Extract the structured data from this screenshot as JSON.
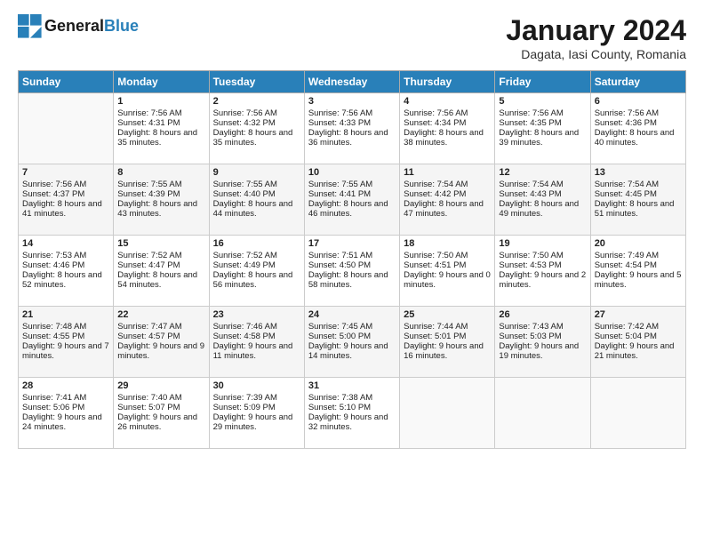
{
  "header": {
    "logo_line1": "General",
    "logo_line2": "Blue",
    "month": "January 2024",
    "location": "Dagata, Iasi County, Romania"
  },
  "days_of_week": [
    "Sunday",
    "Monday",
    "Tuesday",
    "Wednesday",
    "Thursday",
    "Friday",
    "Saturday"
  ],
  "weeks": [
    [
      {
        "day": "",
        "content": ""
      },
      {
        "day": "1",
        "sunrise": "Sunrise: 7:56 AM",
        "sunset": "Sunset: 4:31 PM",
        "daylight": "Daylight: 8 hours and 35 minutes."
      },
      {
        "day": "2",
        "sunrise": "Sunrise: 7:56 AM",
        "sunset": "Sunset: 4:32 PM",
        "daylight": "Daylight: 8 hours and 35 minutes."
      },
      {
        "day": "3",
        "sunrise": "Sunrise: 7:56 AM",
        "sunset": "Sunset: 4:33 PM",
        "daylight": "Daylight: 8 hours and 36 minutes."
      },
      {
        "day": "4",
        "sunrise": "Sunrise: 7:56 AM",
        "sunset": "Sunset: 4:34 PM",
        "daylight": "Daylight: 8 hours and 38 minutes."
      },
      {
        "day": "5",
        "sunrise": "Sunrise: 7:56 AM",
        "sunset": "Sunset: 4:35 PM",
        "daylight": "Daylight: 8 hours and 39 minutes."
      },
      {
        "day": "6",
        "sunrise": "Sunrise: 7:56 AM",
        "sunset": "Sunset: 4:36 PM",
        "daylight": "Daylight: 8 hours and 40 minutes."
      }
    ],
    [
      {
        "day": "7",
        "sunrise": "Sunrise: 7:56 AM",
        "sunset": "Sunset: 4:37 PM",
        "daylight": "Daylight: 8 hours and 41 minutes."
      },
      {
        "day": "8",
        "sunrise": "Sunrise: 7:55 AM",
        "sunset": "Sunset: 4:39 PM",
        "daylight": "Daylight: 8 hours and 43 minutes."
      },
      {
        "day": "9",
        "sunrise": "Sunrise: 7:55 AM",
        "sunset": "Sunset: 4:40 PM",
        "daylight": "Daylight: 8 hours and 44 minutes."
      },
      {
        "day": "10",
        "sunrise": "Sunrise: 7:55 AM",
        "sunset": "Sunset: 4:41 PM",
        "daylight": "Daylight: 8 hours and 46 minutes."
      },
      {
        "day": "11",
        "sunrise": "Sunrise: 7:54 AM",
        "sunset": "Sunset: 4:42 PM",
        "daylight": "Daylight: 8 hours and 47 minutes."
      },
      {
        "day": "12",
        "sunrise": "Sunrise: 7:54 AM",
        "sunset": "Sunset: 4:43 PM",
        "daylight": "Daylight: 8 hours and 49 minutes."
      },
      {
        "day": "13",
        "sunrise": "Sunrise: 7:54 AM",
        "sunset": "Sunset: 4:45 PM",
        "daylight": "Daylight: 8 hours and 51 minutes."
      }
    ],
    [
      {
        "day": "14",
        "sunrise": "Sunrise: 7:53 AM",
        "sunset": "Sunset: 4:46 PM",
        "daylight": "Daylight: 8 hours and 52 minutes."
      },
      {
        "day": "15",
        "sunrise": "Sunrise: 7:52 AM",
        "sunset": "Sunset: 4:47 PM",
        "daylight": "Daylight: 8 hours and 54 minutes."
      },
      {
        "day": "16",
        "sunrise": "Sunrise: 7:52 AM",
        "sunset": "Sunset: 4:49 PM",
        "daylight": "Daylight: 8 hours and 56 minutes."
      },
      {
        "day": "17",
        "sunrise": "Sunrise: 7:51 AM",
        "sunset": "Sunset: 4:50 PM",
        "daylight": "Daylight: 8 hours and 58 minutes."
      },
      {
        "day": "18",
        "sunrise": "Sunrise: 7:50 AM",
        "sunset": "Sunset: 4:51 PM",
        "daylight": "Daylight: 9 hours and 0 minutes."
      },
      {
        "day": "19",
        "sunrise": "Sunrise: 7:50 AM",
        "sunset": "Sunset: 4:53 PM",
        "daylight": "Daylight: 9 hours and 2 minutes."
      },
      {
        "day": "20",
        "sunrise": "Sunrise: 7:49 AM",
        "sunset": "Sunset: 4:54 PM",
        "daylight": "Daylight: 9 hours and 5 minutes."
      }
    ],
    [
      {
        "day": "21",
        "sunrise": "Sunrise: 7:48 AM",
        "sunset": "Sunset: 4:55 PM",
        "daylight": "Daylight: 9 hours and 7 minutes."
      },
      {
        "day": "22",
        "sunrise": "Sunrise: 7:47 AM",
        "sunset": "Sunset: 4:57 PM",
        "daylight": "Daylight: 9 hours and 9 minutes."
      },
      {
        "day": "23",
        "sunrise": "Sunrise: 7:46 AM",
        "sunset": "Sunset: 4:58 PM",
        "daylight": "Daylight: 9 hours and 11 minutes."
      },
      {
        "day": "24",
        "sunrise": "Sunrise: 7:45 AM",
        "sunset": "Sunset: 5:00 PM",
        "daylight": "Daylight: 9 hours and 14 minutes."
      },
      {
        "day": "25",
        "sunrise": "Sunrise: 7:44 AM",
        "sunset": "Sunset: 5:01 PM",
        "daylight": "Daylight: 9 hours and 16 minutes."
      },
      {
        "day": "26",
        "sunrise": "Sunrise: 7:43 AM",
        "sunset": "Sunset: 5:03 PM",
        "daylight": "Daylight: 9 hours and 19 minutes."
      },
      {
        "day": "27",
        "sunrise": "Sunrise: 7:42 AM",
        "sunset": "Sunset: 5:04 PM",
        "daylight": "Daylight: 9 hours and 21 minutes."
      }
    ],
    [
      {
        "day": "28",
        "sunrise": "Sunrise: 7:41 AM",
        "sunset": "Sunset: 5:06 PM",
        "daylight": "Daylight: 9 hours and 24 minutes."
      },
      {
        "day": "29",
        "sunrise": "Sunrise: 7:40 AM",
        "sunset": "Sunset: 5:07 PM",
        "daylight": "Daylight: 9 hours and 26 minutes."
      },
      {
        "day": "30",
        "sunrise": "Sunrise: 7:39 AM",
        "sunset": "Sunset: 5:09 PM",
        "daylight": "Daylight: 9 hours and 29 minutes."
      },
      {
        "day": "31",
        "sunrise": "Sunrise: 7:38 AM",
        "sunset": "Sunset: 5:10 PM",
        "daylight": "Daylight: 9 hours and 32 minutes."
      },
      {
        "day": "",
        "content": ""
      },
      {
        "day": "",
        "content": ""
      },
      {
        "day": "",
        "content": ""
      }
    ]
  ]
}
